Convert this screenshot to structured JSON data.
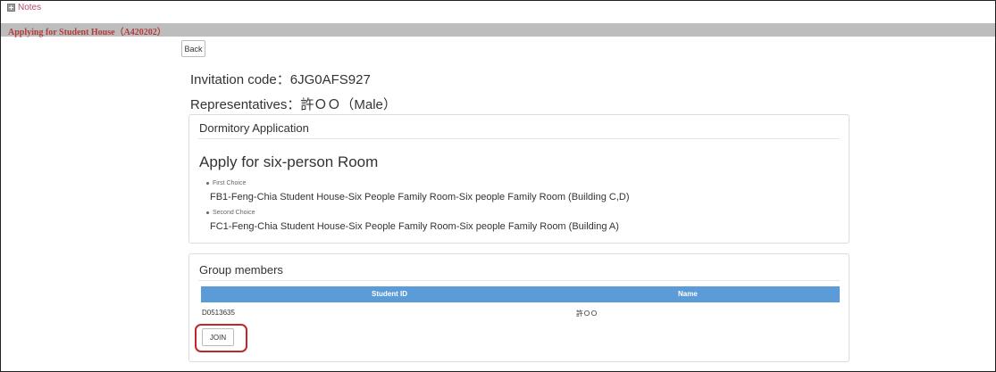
{
  "notes_label": "Notes",
  "page_title": "Applying for Student House（A420202）",
  "back_label": "Back",
  "invitation_code_text": "Invitation code：6JG0AFS927",
  "representatives_text": "Representatives：許ＯＯ（Male）",
  "application_panel": {
    "title": "Dormitory Application",
    "heading": "Apply for six-person Room",
    "choices": [
      {
        "label": "First Choice",
        "value": "FB1-Feng-Chia Student House-Six People Family Room-Six people Family Room (Building C,D)"
      },
      {
        "label": "Second Choice",
        "value": "FC1-Feng-Chia Student House-Six People Family Room-Six people Family Room (Building A)"
      }
    ]
  },
  "members_panel": {
    "title": "Group members",
    "columns": [
      "Student ID",
      "Name"
    ],
    "rows": [
      {
        "student_id": "D0513635",
        "name": "許ＯＯ"
      }
    ],
    "join_label": "JOIN"
  },
  "colors": {
    "table_header": "#5b9bd8",
    "title_bar": "#bdbdbd",
    "title_text": "#b33b3b",
    "highlight_outline": "#c0272d"
  }
}
